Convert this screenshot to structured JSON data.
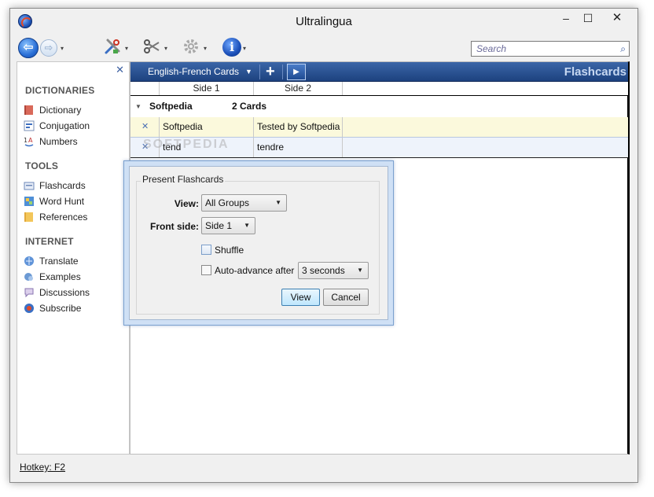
{
  "window": {
    "title": "Ultralingua",
    "minimize_glyph": "–",
    "maximize_glyph": "☐",
    "close_glyph": "✕"
  },
  "toolbar": {
    "back_glyph": "⇦",
    "forward_glyph": "⇨",
    "tools_icon": "tools-icon",
    "clip_icon": "scissors-icon",
    "settings_icon": "gear-icon",
    "info_glyph": "i",
    "search_placeholder": "Search"
  },
  "sidebar": {
    "close_glyph": "✕",
    "sections": [
      {
        "title": "DICTIONARIES",
        "items": [
          {
            "label": "Dictionary",
            "icon": "book-icon"
          },
          {
            "label": "Conjugation",
            "icon": "conjugation-icon"
          },
          {
            "label": "Numbers",
            "icon": "numbers-icon"
          }
        ]
      },
      {
        "title": "TOOLS",
        "items": [
          {
            "label": "Flashcards",
            "icon": "flashcards-icon"
          },
          {
            "label": "Word Hunt",
            "icon": "word-hunt-icon"
          },
          {
            "label": "References",
            "icon": "references-icon"
          }
        ]
      },
      {
        "title": "INTERNET",
        "items": [
          {
            "label": "Translate",
            "icon": "translate-icon"
          },
          {
            "label": "Examples",
            "icon": "examples-icon"
          },
          {
            "label": "Discussions",
            "icon": "discussions-icon"
          },
          {
            "label": "Subscribe",
            "icon": "subscribe-icon"
          }
        ]
      }
    ]
  },
  "deck": {
    "selected": "English-French Cards",
    "add_glyph": "+",
    "play_glyph": "▶",
    "panel_title": "Flashcards",
    "columns": [
      "Side 1",
      "Side 2"
    ],
    "group": {
      "name": "Softpedia",
      "count": "2 Cards"
    },
    "cards": [
      {
        "side1": "Softpedia",
        "side2": "Tested by Softpedia"
      },
      {
        "side1": "tend",
        "side2": "tendre"
      }
    ],
    "watermark": "SOFTPEDIA"
  },
  "dialog": {
    "group_title": "Present Flashcards",
    "view_label": "View:",
    "view_value": "All Groups",
    "front_label": "Front side:",
    "front_value": "Side 1",
    "shuffle_label": "Shuffle",
    "shuffle_checked": false,
    "autoadvance_label": "Auto-advance after",
    "autoadvance_checked": false,
    "autoadvance_value": "3 seconds",
    "view_button": "View",
    "cancel_button": "Cancel"
  },
  "status": {
    "hotkey": "Hotkey: F2"
  },
  "colors": {
    "deck_bar": "#2a5496",
    "highlight_row": "#fbf9dc",
    "dialog_border": "#cfe0f5"
  }
}
